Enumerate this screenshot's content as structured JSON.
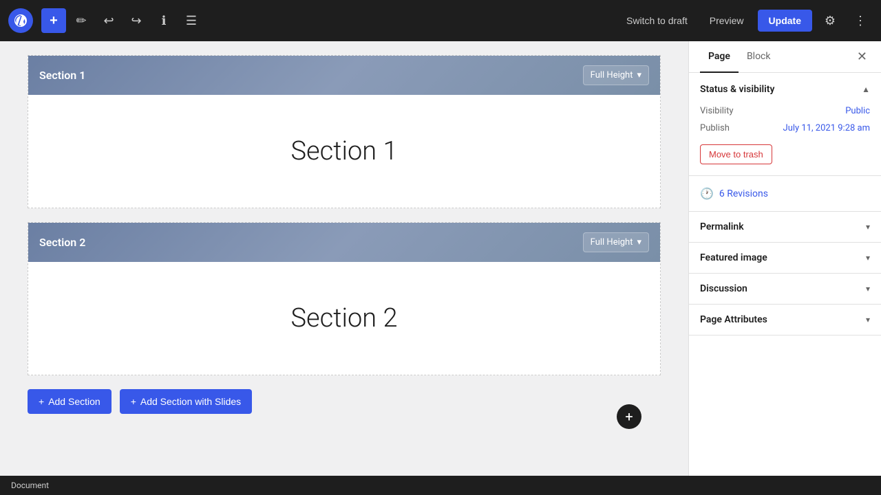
{
  "toolbar": {
    "add_label": "+",
    "undo_label": "↩",
    "redo_label": "↪",
    "info_label": "ℹ",
    "list_view_label": "☰",
    "switch_to_draft": "Switch to draft",
    "preview": "Preview",
    "update": "Update",
    "settings_icon": "⚙",
    "more_icon": "⋮"
  },
  "sections": [
    {
      "id": "section-1",
      "header_title": "Section 1",
      "dropdown_value": "Full Height",
      "content_title": "Section 1"
    },
    {
      "id": "section-2",
      "header_title": "Section 2",
      "dropdown_value": "Full Height",
      "content_title": "Section 2"
    }
  ],
  "add_buttons": [
    {
      "label": "Add Section"
    },
    {
      "label": "Add Section with Slides"
    }
  ],
  "status_bar": {
    "label": "Document"
  },
  "sidebar": {
    "tabs": [
      {
        "label": "Page",
        "active": true
      },
      {
        "label": "Block",
        "active": false
      }
    ],
    "status_visibility": {
      "title": "Status & visibility",
      "expanded": true,
      "visibility_label": "Visibility",
      "visibility_value": "Public",
      "publish_label": "Publish",
      "publish_value": "July 11, 2021 9:28 am",
      "move_trash_label": "Move to trash"
    },
    "revisions": {
      "count": "6",
      "label": "6 Revisions"
    },
    "permalink": {
      "title": "Permalink"
    },
    "featured_image": {
      "title": "Featured image"
    },
    "discussion": {
      "title": "Discussion"
    },
    "page_attributes": {
      "title": "Page Attributes"
    }
  }
}
